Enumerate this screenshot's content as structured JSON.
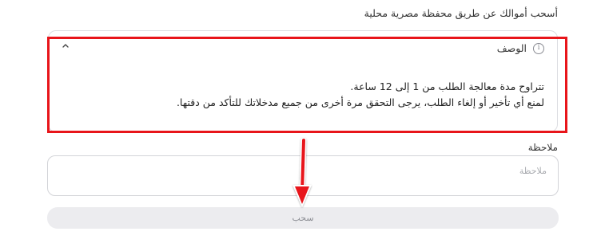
{
  "withdraw_title": "أسحب أموالك عن طريق محفظة مصرية محلية",
  "description": {
    "header": "الوصف",
    "line1": "تتراوح مدة معالجة الطلب من 1 إلى 12 ساعة.",
    "line2": "لمنع أي تأخير أو إلغاء الطلب، يرجى التحقق مرة أخرى من جميع مدخلاتك للتأكد من دقتها."
  },
  "note": {
    "label": "ملاحظة",
    "placeholder": "ملاحظة"
  },
  "submit_button": "سحب",
  "colors": {
    "annotation_red": "#e8151a",
    "button_bg": "#ececef"
  },
  "icons": {
    "info": "info-icon",
    "collapse": "chevron-up-icon"
  }
}
